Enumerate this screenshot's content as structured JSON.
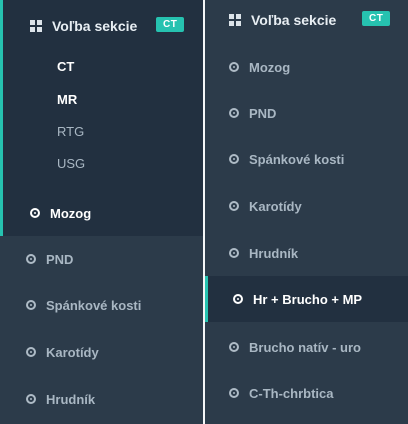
{
  "colors": {
    "background": "#2c3b4a",
    "active_background": "#223040",
    "accent": "#26c2b0",
    "text_muted": "#a9b7c3",
    "text_active": "#ffffff"
  },
  "left": {
    "section_label": "Voľba sekcie",
    "section_badge": "CT",
    "modalities": [
      {
        "label": "CT",
        "selected": true
      },
      {
        "label": "MR",
        "selected": true
      },
      {
        "label": "RTG",
        "selected": false
      },
      {
        "label": "USG",
        "selected": false
      }
    ],
    "items": [
      {
        "label": "Mozog",
        "active": true
      },
      {
        "label": "PND",
        "active": false
      },
      {
        "label": "Spánkové kosti",
        "active": false
      },
      {
        "label": "Karotídy",
        "active": false
      },
      {
        "label": "Hrudník",
        "active": false
      }
    ]
  },
  "right": {
    "section_label": "Voľba sekcie",
    "section_badge": "CT",
    "items": [
      {
        "label": "Mozog",
        "active": false
      },
      {
        "label": "PND",
        "active": false
      },
      {
        "label": "Spánkové kosti",
        "active": false
      },
      {
        "label": "Karotídy",
        "active": false
      },
      {
        "label": "Hrudník",
        "active": false
      },
      {
        "label": "Hr + Brucho + MP",
        "active": true
      },
      {
        "label": "Brucho natív - uro",
        "active": false
      },
      {
        "label": "C-Th-chrbtica",
        "active": false
      }
    ]
  }
}
